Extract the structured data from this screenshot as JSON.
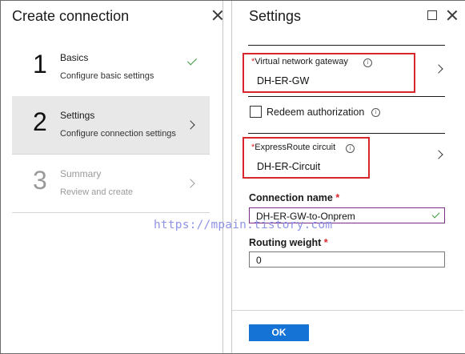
{
  "left_blade": {
    "title": "Create connection",
    "steps": [
      {
        "number": "1",
        "name": "Basics",
        "description": "Configure basic settings",
        "state": "complete"
      },
      {
        "number": "2",
        "name": "Settings",
        "description": "Configure connection settings",
        "state": "active"
      },
      {
        "number": "3",
        "name": "Summary",
        "description": "Review and create",
        "state": "disabled"
      }
    ]
  },
  "right_blade": {
    "title": "Settings",
    "virtual_network_gateway": {
      "required_mark": "*",
      "label": "Virtual network gateway",
      "value": "DH-ER-GW"
    },
    "redeem_authorization": {
      "label": "Redeem authorization",
      "checked": false
    },
    "expressroute_circuit": {
      "required_mark": "*",
      "label": "ExpressRoute circuit",
      "value": "DH-ER-Circuit"
    },
    "connection_name": {
      "label": "Connection name",
      "required_mark": "*",
      "value": "DH-ER-GW-to-Onprem"
    },
    "routing_weight": {
      "label": "Routing weight",
      "required_mark": "*",
      "value": "0"
    },
    "ok_label": "OK"
  },
  "watermark": "https://mpain.tistory.com",
  "colors": {
    "accent": "#1673d6",
    "highlight": "#d9262c",
    "success": "#3b9a3b",
    "watermark": "#8f93e6"
  }
}
